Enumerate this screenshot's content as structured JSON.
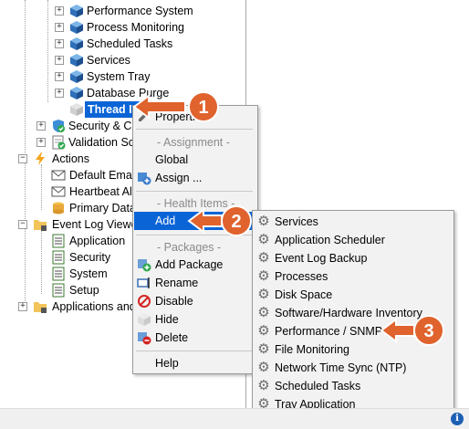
{
  "tree": {
    "items": [
      {
        "label": "Performance System"
      },
      {
        "label": "Process Monitoring"
      },
      {
        "label": "Scheduled Tasks"
      },
      {
        "label": "Services"
      },
      {
        "label": "System Tray"
      },
      {
        "label": "Database Purge"
      },
      {
        "label": "Thread In"
      },
      {
        "label": "Security & Co"
      },
      {
        "label": "Validation Sc"
      },
      {
        "label": "Actions"
      },
      {
        "label": "Default Emai"
      },
      {
        "label": "Heartbeat Ale"
      },
      {
        "label": "Primary Data"
      },
      {
        "label": "Event Log Viewe"
      },
      {
        "label": "Application"
      },
      {
        "label": "Security"
      },
      {
        "label": "System"
      },
      {
        "label": "Setup"
      },
      {
        "label": "Applications and"
      }
    ]
  },
  "context_menu": {
    "properties": "Properties",
    "assignment_header": "- Assignment -",
    "global": "Global",
    "assign": "Assign ...",
    "health_header": "- Health Items -",
    "add": "Add",
    "packages_header": "- Packages -",
    "add_package": "Add Package",
    "rename": "Rename",
    "disable": "Disable",
    "hide": "Hide",
    "delete": "Delete",
    "help": "Help"
  },
  "submenu": {
    "items": [
      "Services",
      "Application Scheduler",
      "Event Log Backup",
      "Processes",
      "Disk Space",
      "Software/Hardware Inventory",
      "Performance / SNMP",
      "File Monitoring",
      "Network Time Sync (NTP)",
      "Scheduled Tasks",
      "Tray Application"
    ]
  },
  "callouts": [
    "1",
    "2",
    "3"
  ],
  "status": {
    "info_icon": "i"
  },
  "colors": {
    "accent": "#0a64d6",
    "callout": "#e0622d"
  }
}
